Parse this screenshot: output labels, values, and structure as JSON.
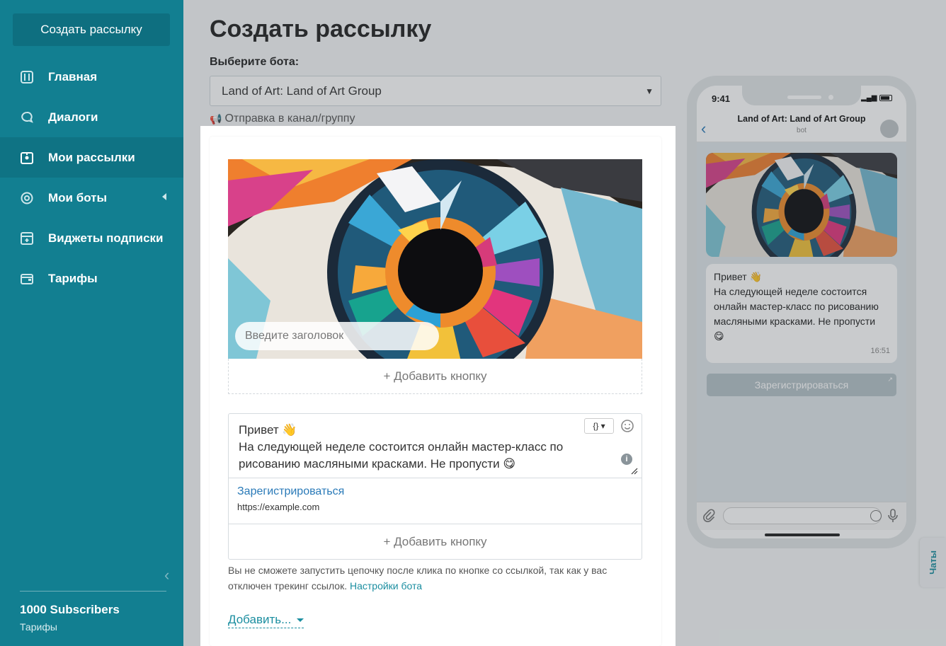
{
  "sidebar": {
    "create_button": "Создать рассылку",
    "items": [
      {
        "label": "Главная",
        "icon": "sliders-icon"
      },
      {
        "label": "Диалоги",
        "icon": "chat-bubble-icon"
      },
      {
        "label": "Мои рассылки",
        "icon": "broadcast-icon"
      },
      {
        "label": "Мои боты",
        "icon": "bot-icon"
      },
      {
        "label": "Виджеты подписки",
        "icon": "widget-icon"
      },
      {
        "label": "Тарифы",
        "icon": "wallet-icon"
      }
    ],
    "active_item": "Мои рассылки",
    "plan_name": "1000 Subscribers",
    "plan_link": "Тарифы"
  },
  "page": {
    "title": "Создать рассылку",
    "bot_label": "Выберите бота:",
    "bot_selected": "Land of Art: Land of Art Group",
    "channel_link": "Отправка в канал/группу"
  },
  "editor": {
    "title_placeholder": "Введите заголовок",
    "add_button_label": "+ Добавить кнопку",
    "message_line1": "Привет 👋",
    "message_line2": "На следующей неделе состоится онлайн мастер-класс по",
    "message_line3": "рисованию масляными красками. Не пропусти 😋",
    "var_button": "{}",
    "link_button_title": "Зарегистрироваться",
    "link_button_url": "https://example.com",
    "add_button_label_2": "+ Добавить кнопку",
    "warning_text": "Вы не сможете запустить цепочку после клика по кнопке со ссылкой, так как у вас отключен трекинг ссылок.",
    "warning_link": "Настройки бота",
    "add_more": "Добавить..."
  },
  "preview": {
    "time": "9:41",
    "chat_title": "Land of Art: Land of Art Group",
    "chat_sub": "bot",
    "msg_line1": "Привет 👋",
    "msg_line2": "На следующей неделе состоится",
    "msg_line3": "онлайн мастер-класс по рисованию",
    "msg_line4": "масляными красками. Не пропусти",
    "msg_line5": "😋",
    "msg_time": "16:51",
    "button_label": "Зарегистрироваться"
  },
  "chats_tab": "Чаты",
  "colors": {
    "sidebar": "#127f91",
    "accent": "#1b8ea0",
    "link": "#2a7ab8"
  }
}
